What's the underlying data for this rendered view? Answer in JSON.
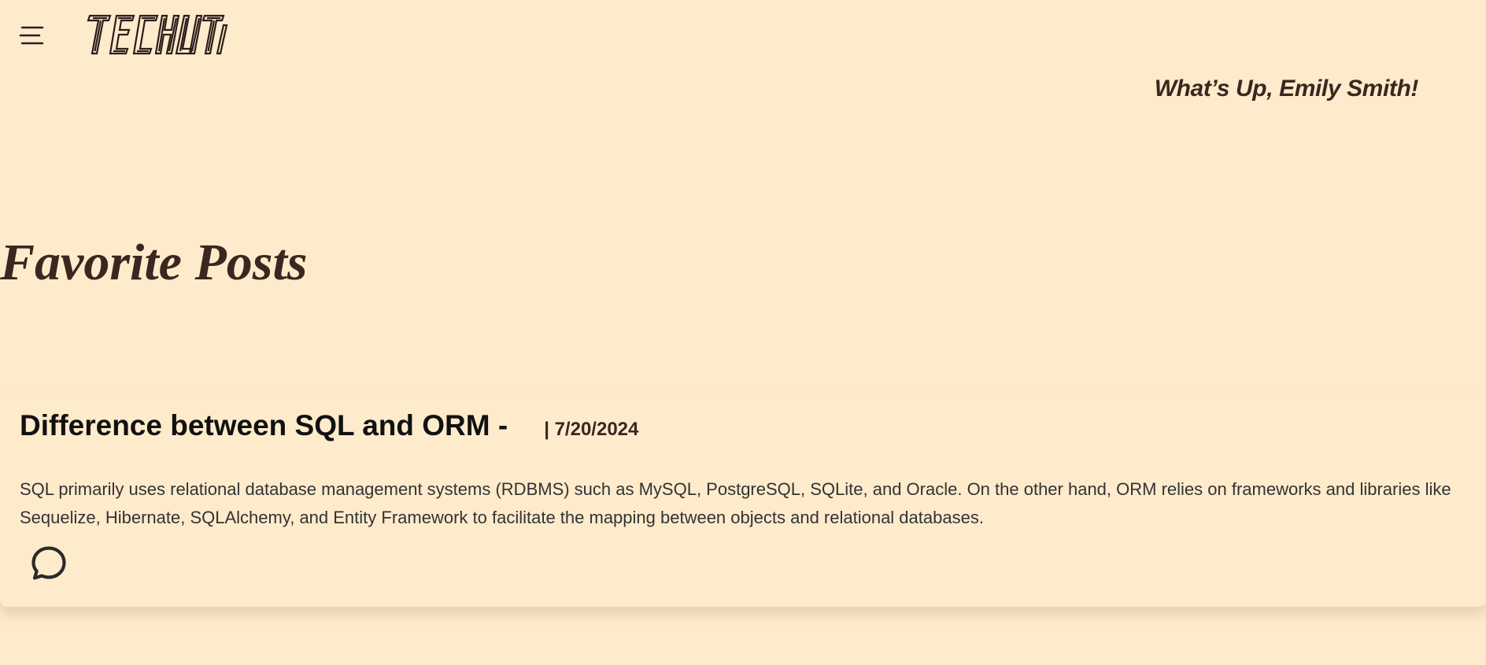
{
  "header": {
    "menu_icon": "hamburger-menu-icon",
    "logo_text": "TECHLITH"
  },
  "greeting": "What’s Up, Emily Smith!",
  "section_title": "Favorite Posts",
  "posts": [
    {
      "title": "Difference between SQL and ORM -",
      "date": "| 7/20/2024",
      "excerpt": "SQL primarily uses relational database management systems (RDBMS) such as MySQL, PostgreSQL, SQLite, and Oracle. On the other hand, ORM relies on frameworks and libraries like Sequelize, Hibernate, SQLAlchemy, and Entity Framework to facilitate the mapping between objects and relational databases.",
      "comment_icon": "comment-icon"
    }
  ],
  "colors": {
    "background": "#FEEBCC",
    "primary_text": "#3B2620",
    "title_text": "#111111",
    "body_text": "#333333"
  }
}
